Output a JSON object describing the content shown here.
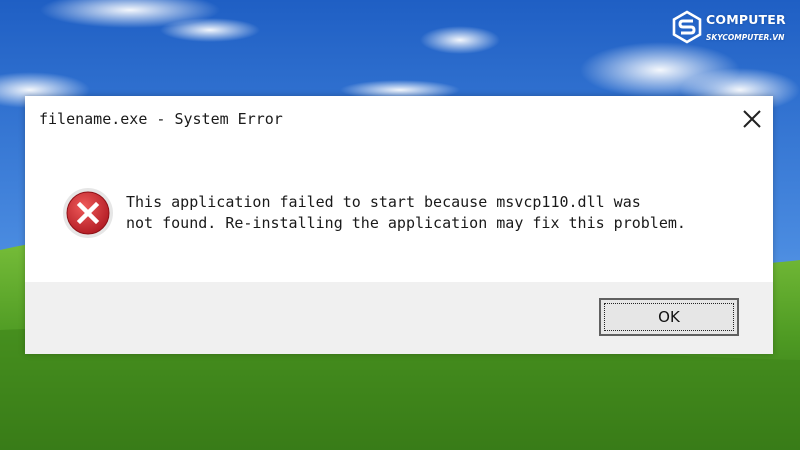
{
  "dialog": {
    "title": "filename.exe - System Error",
    "message_line_1": "This application failed to start because msvcp110.dll was",
    "message_line_2": "not found. Re-installing the application may fix this problem.",
    "ok_label": "OK",
    "close_icon": "close-icon",
    "error_icon": "error-icon"
  },
  "watermark": {
    "brand": "COMPUTER",
    "url": "SKYCOMPUTER.VN",
    "icon": "logo-mark-icon"
  },
  "colors": {
    "sky": "#3a7bd5",
    "grass": "#4f9a2a",
    "error_red": "#c8202a",
    "dialog_footer": "#f0f0f0"
  }
}
